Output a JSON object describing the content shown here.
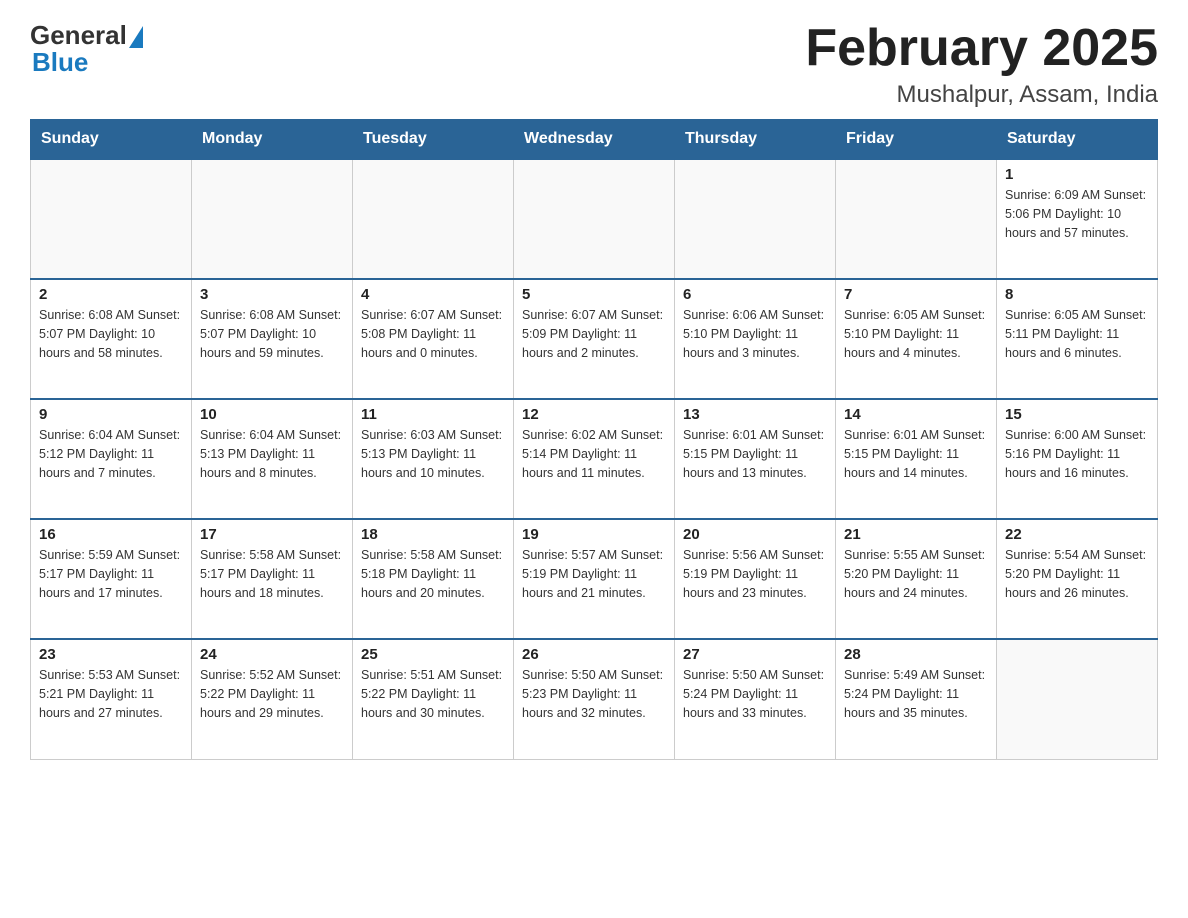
{
  "logo": {
    "general": "General",
    "blue": "Blue"
  },
  "title": {
    "month_year": "February 2025",
    "location": "Mushalpur, Assam, India"
  },
  "headers": [
    "Sunday",
    "Monday",
    "Tuesday",
    "Wednesday",
    "Thursday",
    "Friday",
    "Saturday"
  ],
  "weeks": [
    [
      {
        "day": "",
        "info": ""
      },
      {
        "day": "",
        "info": ""
      },
      {
        "day": "",
        "info": ""
      },
      {
        "day": "",
        "info": ""
      },
      {
        "day": "",
        "info": ""
      },
      {
        "day": "",
        "info": ""
      },
      {
        "day": "1",
        "info": "Sunrise: 6:09 AM\nSunset: 5:06 PM\nDaylight: 10 hours and 57 minutes."
      }
    ],
    [
      {
        "day": "2",
        "info": "Sunrise: 6:08 AM\nSunset: 5:07 PM\nDaylight: 10 hours and 58 minutes."
      },
      {
        "day": "3",
        "info": "Sunrise: 6:08 AM\nSunset: 5:07 PM\nDaylight: 10 hours and 59 minutes."
      },
      {
        "day": "4",
        "info": "Sunrise: 6:07 AM\nSunset: 5:08 PM\nDaylight: 11 hours and 0 minutes."
      },
      {
        "day": "5",
        "info": "Sunrise: 6:07 AM\nSunset: 5:09 PM\nDaylight: 11 hours and 2 minutes."
      },
      {
        "day": "6",
        "info": "Sunrise: 6:06 AM\nSunset: 5:10 PM\nDaylight: 11 hours and 3 minutes."
      },
      {
        "day": "7",
        "info": "Sunrise: 6:05 AM\nSunset: 5:10 PM\nDaylight: 11 hours and 4 minutes."
      },
      {
        "day": "8",
        "info": "Sunrise: 6:05 AM\nSunset: 5:11 PM\nDaylight: 11 hours and 6 minutes."
      }
    ],
    [
      {
        "day": "9",
        "info": "Sunrise: 6:04 AM\nSunset: 5:12 PM\nDaylight: 11 hours and 7 minutes."
      },
      {
        "day": "10",
        "info": "Sunrise: 6:04 AM\nSunset: 5:13 PM\nDaylight: 11 hours and 8 minutes."
      },
      {
        "day": "11",
        "info": "Sunrise: 6:03 AM\nSunset: 5:13 PM\nDaylight: 11 hours and 10 minutes."
      },
      {
        "day": "12",
        "info": "Sunrise: 6:02 AM\nSunset: 5:14 PM\nDaylight: 11 hours and 11 minutes."
      },
      {
        "day": "13",
        "info": "Sunrise: 6:01 AM\nSunset: 5:15 PM\nDaylight: 11 hours and 13 minutes."
      },
      {
        "day": "14",
        "info": "Sunrise: 6:01 AM\nSunset: 5:15 PM\nDaylight: 11 hours and 14 minutes."
      },
      {
        "day": "15",
        "info": "Sunrise: 6:00 AM\nSunset: 5:16 PM\nDaylight: 11 hours and 16 minutes."
      }
    ],
    [
      {
        "day": "16",
        "info": "Sunrise: 5:59 AM\nSunset: 5:17 PM\nDaylight: 11 hours and 17 minutes."
      },
      {
        "day": "17",
        "info": "Sunrise: 5:58 AM\nSunset: 5:17 PM\nDaylight: 11 hours and 18 minutes."
      },
      {
        "day": "18",
        "info": "Sunrise: 5:58 AM\nSunset: 5:18 PM\nDaylight: 11 hours and 20 minutes."
      },
      {
        "day": "19",
        "info": "Sunrise: 5:57 AM\nSunset: 5:19 PM\nDaylight: 11 hours and 21 minutes."
      },
      {
        "day": "20",
        "info": "Sunrise: 5:56 AM\nSunset: 5:19 PM\nDaylight: 11 hours and 23 minutes."
      },
      {
        "day": "21",
        "info": "Sunrise: 5:55 AM\nSunset: 5:20 PM\nDaylight: 11 hours and 24 minutes."
      },
      {
        "day": "22",
        "info": "Sunrise: 5:54 AM\nSunset: 5:20 PM\nDaylight: 11 hours and 26 minutes."
      }
    ],
    [
      {
        "day": "23",
        "info": "Sunrise: 5:53 AM\nSunset: 5:21 PM\nDaylight: 11 hours and 27 minutes."
      },
      {
        "day": "24",
        "info": "Sunrise: 5:52 AM\nSunset: 5:22 PM\nDaylight: 11 hours and 29 minutes."
      },
      {
        "day": "25",
        "info": "Sunrise: 5:51 AM\nSunset: 5:22 PM\nDaylight: 11 hours and 30 minutes."
      },
      {
        "day": "26",
        "info": "Sunrise: 5:50 AM\nSunset: 5:23 PM\nDaylight: 11 hours and 32 minutes."
      },
      {
        "day": "27",
        "info": "Sunrise: 5:50 AM\nSunset: 5:24 PM\nDaylight: 11 hours and 33 minutes."
      },
      {
        "day": "28",
        "info": "Sunrise: 5:49 AM\nSunset: 5:24 PM\nDaylight: 11 hours and 35 minutes."
      },
      {
        "day": "",
        "info": ""
      }
    ]
  ]
}
